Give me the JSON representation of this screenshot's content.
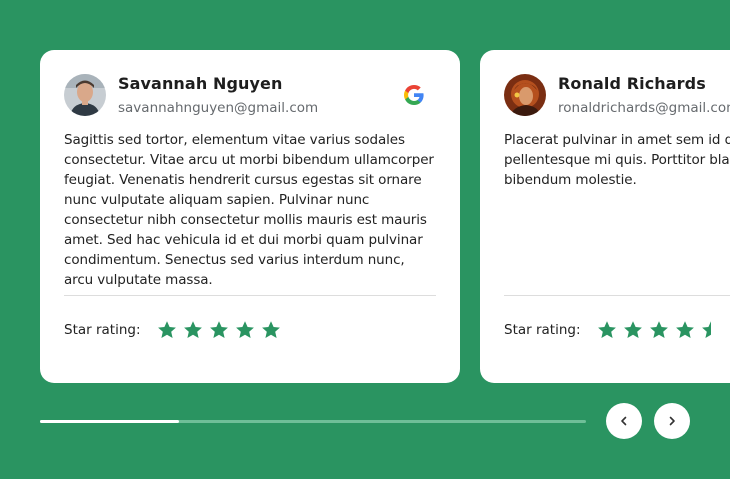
{
  "reviews": [
    {
      "name": "Savannah Nguyen",
      "email": "savannahnguyen@gmail.com",
      "text": "Sagittis sed tortor, elementum vitae varius sodales consectetur. Vitae arcu ut morbi bibendum ullamcorper feugiat. Venenatis hendrerit cursus egestas sit ornare nunc vulputate aliquam sapien. Pulvinar nunc consectetur nibh consectetur mollis mauris est mauris amet. Sed hac vehicula id et dui morbi quam pulvinar condimentum. Senectus sed varius interdum nunc, arcu vulputate massa.",
      "rating_label": "Star rating:",
      "rating": 5,
      "source_icon": "google-icon"
    },
    {
      "name": "Ronald Richards",
      "email": "ronaldrichards@gmail.com",
      "text": "Placerat pulvinar in amet sem id dignissim est pellentesque mi quis. Porttitor blandit auctor odio a orci bibendum molestie.",
      "rating_label": "Star rating:",
      "rating": 4.5
    }
  ],
  "carousel": {
    "progress": 0.255,
    "prev_icon": "chevron-left-icon",
    "next_icon": "chevron-right-icon"
  },
  "colors": {
    "background": "#2a9461",
    "star": "#2a9461",
    "card": "#ffffff"
  }
}
